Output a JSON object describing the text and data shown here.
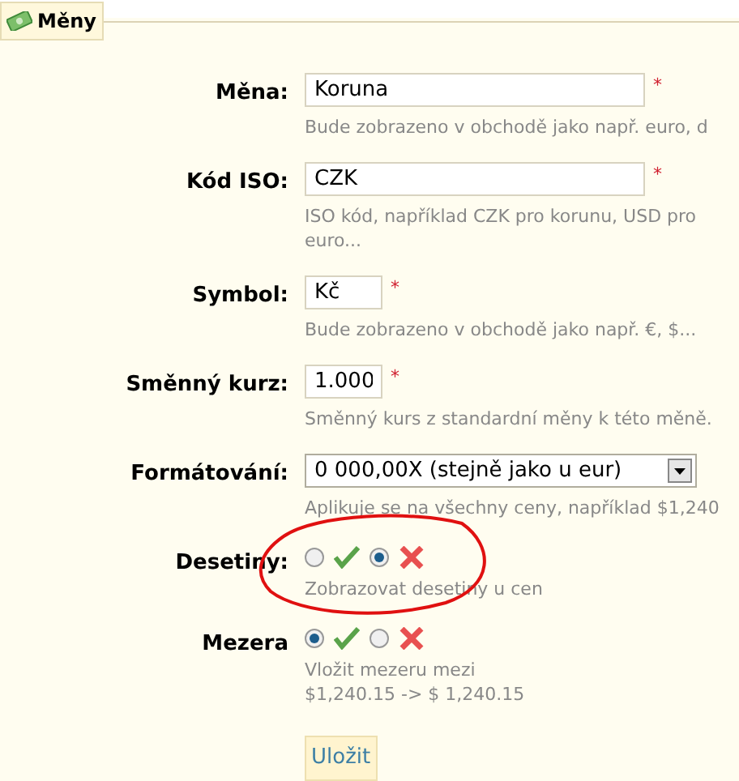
{
  "legend": {
    "title": "Měny"
  },
  "rows": [
    {
      "kind": "text",
      "label": "Měna:",
      "value": "Koruna",
      "mark": "*",
      "hint": [
        "Bude zobrazeno v obchodě jako např. euro, d"
      ]
    },
    {
      "kind": "text",
      "label": "Kód ISO:",
      "value": "CZK",
      "mark": "*",
      "hint": [
        "ISO kód, například CZK pro korunu, USD pro",
        "euro..."
      ]
    },
    {
      "kind": "short",
      "label": "Symbol:",
      "value": "Kč",
      "mark": "*",
      "hint": [
        "Bude zobrazeno v obchodě jako např. €, $..."
      ]
    },
    {
      "kind": "short",
      "label": "Směnný kurz:",
      "value": "1.000",
      "mark": "*",
      "hint": [
        "Směnný kurs z standardní měny k této měně."
      ]
    },
    {
      "kind": "select",
      "label": "Formátování:",
      "value": "0 000,00X (stejně jako u eur)",
      "hint": [
        "Aplikuje se na všechny ceny, například $1,240"
      ]
    },
    {
      "kind": "yesno",
      "label": "Desetiny:",
      "yes": false,
      "circled": true,
      "hint": [
        "Zobrazovat desetiny u cen"
      ]
    },
    {
      "kind": "yesno",
      "label": "Mezera",
      "yes": true,
      "circled": false,
      "hint": [
        "Vložit mezeru mezi",
        "$1,240.15 -> $ 1,240.15"
      ]
    }
  ],
  "submit": {
    "label": "Uložit"
  }
}
